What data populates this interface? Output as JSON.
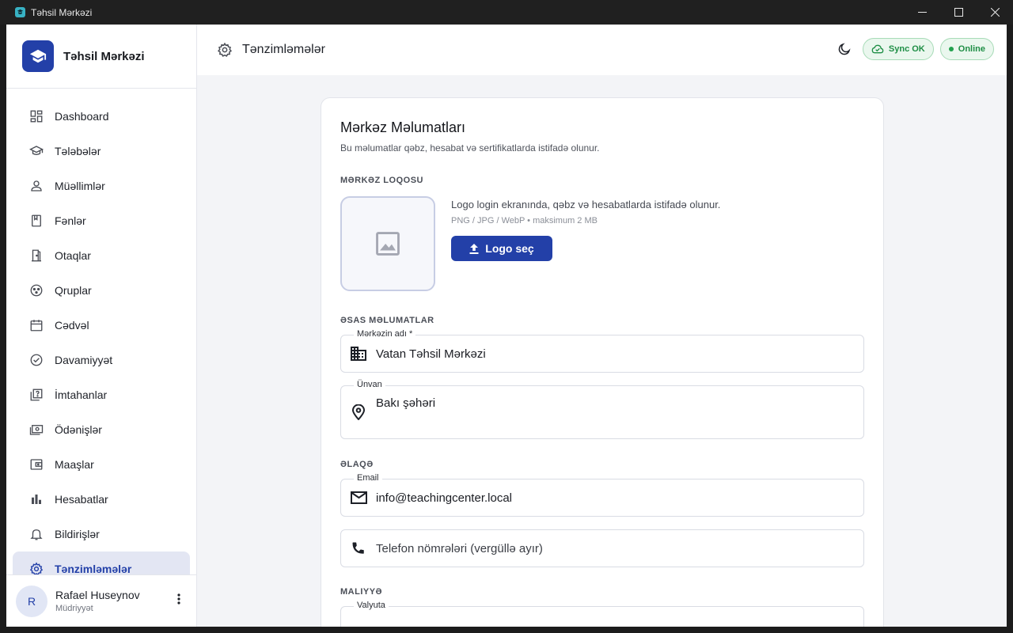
{
  "window": {
    "title": "Təhsil Mərkəzi"
  },
  "brand": {
    "name": "Təhsil Mərkəzi"
  },
  "nav": [
    {
      "label": "Dashboard",
      "icon": "dashboard-icon"
    },
    {
      "label": "Tələbələr",
      "icon": "graduation-cap-icon"
    },
    {
      "label": "Müəllimlər",
      "icon": "person-icon"
    },
    {
      "label": "Fənlər",
      "icon": "book-icon"
    },
    {
      "label": "Otaqlar",
      "icon": "door-icon"
    },
    {
      "label": "Qruplar",
      "icon": "group-icon"
    },
    {
      "label": "Cədvəl",
      "icon": "calendar-icon"
    },
    {
      "label": "Davamiyyət",
      "icon": "check-circle-icon"
    },
    {
      "label": "İmtahanlar",
      "icon": "quiz-icon"
    },
    {
      "label": "Ödənişlər",
      "icon": "money-icon"
    },
    {
      "label": "Maaşlar",
      "icon": "wallet-icon"
    },
    {
      "label": "Hesabatlar",
      "icon": "bar-chart-icon"
    },
    {
      "label": "Bildirişlər",
      "icon": "bell-icon"
    },
    {
      "label": "Tənzimləmələr",
      "icon": "gear-icon",
      "active": true
    }
  ],
  "user": {
    "initial": "R",
    "name": "Rafael Huseynov",
    "role": "Müdriyyət"
  },
  "topbar": {
    "title": "Tənzimləmələr",
    "sync_label": "Sync OK",
    "online_label": "Online"
  },
  "card": {
    "title": "Mərkəz Məlumatları",
    "subtitle": "Bu məlumatlar qəbz, hesabat və sertifikatlarda istifadə olunur.",
    "logo_section": "MƏRKƏZ LOQOSU",
    "logo_desc": "Logo login ekranında, qəbz və hesabatlarda istifadə olunur.",
    "logo_hint": "PNG / JPG / WebP • maksimum 2 MB",
    "logo_button": "Logo seç",
    "basic_section": "ƏSAS MƏLUMATLAR",
    "name_label": "Mərkəzin adı *",
    "name_value": "Vatan Təhsil Mərkəzi",
    "address_label": "Ünvan",
    "address_value": "Bakı şəhəri",
    "contact_section": "ƏLAQƏ",
    "email_label": "Email",
    "email_value": "info@teachingcenter.local",
    "phone_placeholder": "Telefon nömrələri (vergüllə ayır)",
    "finance_section": "MALIYYƏ",
    "currency_label": "Valyuta"
  },
  "colors": {
    "primary": "#2340a8",
    "success": "#1e8e45",
    "bg": "#f3f4f7"
  }
}
